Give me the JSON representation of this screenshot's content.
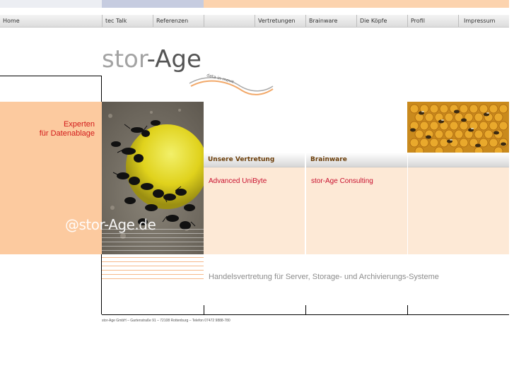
{
  "nav": {
    "items": [
      "Home",
      "tec Talk",
      "Referenzen",
      "Vertretungen",
      "Brainware",
      "Die Köpfe",
      "Profil",
      "Impressum"
    ]
  },
  "logo": {
    "part1": "stor",
    "part2": "-Age",
    "tagline": "data in move"
  },
  "left": {
    "tagline_line1": "Experten",
    "tagline_line2": "für Datenablage"
  },
  "domain": "@stor-Age.de",
  "columns": [
    {
      "heading": "Unsere Vertretung",
      "link": "Advanced UniByte"
    },
    {
      "heading": "Brainware",
      "link": "stor-Age Consulting"
    },
    {
      "heading": "",
      "link": ""
    }
  ],
  "slogan": "Handelsvertretung für Server, Storage- und Archivierungs-Systeme",
  "footer": "stor-Age GmbH – Gartenstraße 91 – 72108 Rottenburg – Telefon 07472 9888-780",
  "colors": {
    "accent_red": "#d21a1a",
    "peach": "#fcca9f",
    "light_peach": "#fde9d6"
  }
}
